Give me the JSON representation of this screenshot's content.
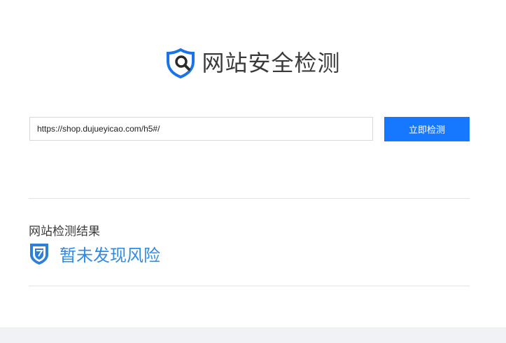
{
  "header": {
    "title": "网站安全检测",
    "logo_icon": "shield-search-icon"
  },
  "search": {
    "url_value": "https://shop.dujueyicao.com/h5#/",
    "button_label": "立即检测"
  },
  "result": {
    "heading": "网站检测结果",
    "status": "暂未发现风险",
    "status_icon": "shield-check-icon"
  },
  "colors": {
    "accent": "#1677ff",
    "status_text": "#2f8be6",
    "divider": "#e3e3e3"
  }
}
